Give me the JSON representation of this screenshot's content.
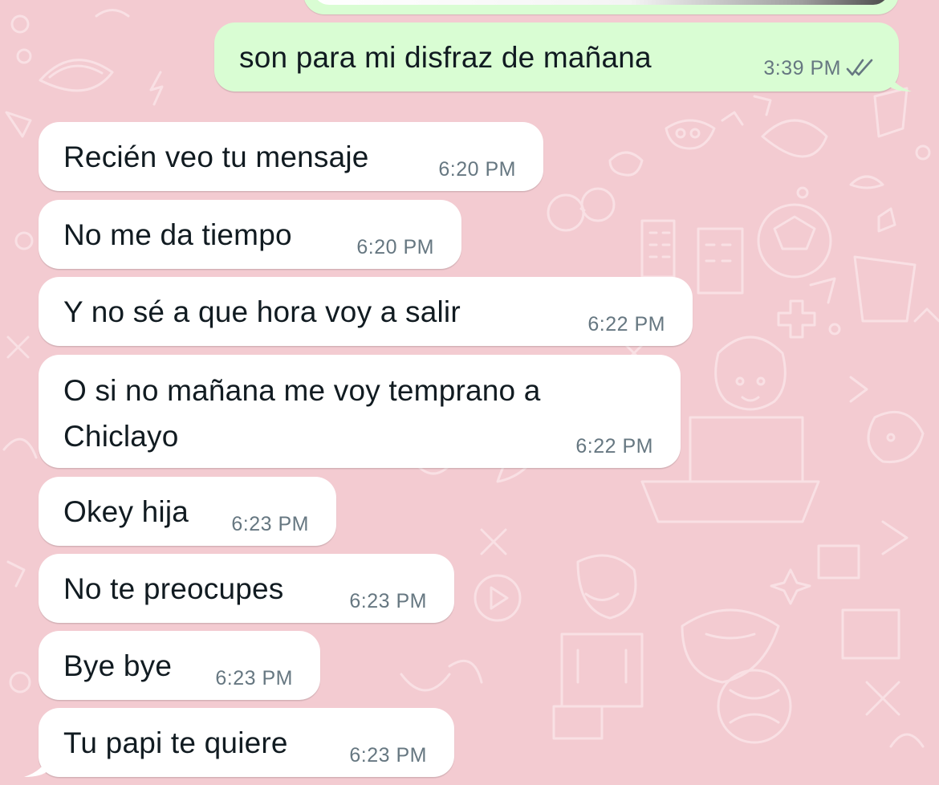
{
  "chat": {
    "colors": {
      "wallpaper": "#f3cbd1",
      "incoming_bubble": "#ffffff",
      "outgoing_bubble": "#d9fdd3",
      "timestamp": "#667781",
      "read_ticks": "#667781"
    },
    "outgoing": [
      {
        "text": "son para mi disfraz de mañana",
        "time": "3:39 PM",
        "status": "read",
        "status_icon": "double-check-icon"
      }
    ],
    "incoming": [
      {
        "text": "Recién veo tu mensaje",
        "time": "6:20 PM"
      },
      {
        "text": "No me da tiempo",
        "time": "6:20 PM"
      },
      {
        "text": "Y no sé a que hora voy a salir",
        "time": "6:22 PM"
      },
      {
        "text": "O si no mañana me voy temprano a Chiclayo",
        "time": "6:22 PM"
      },
      {
        "text": "Okey hija",
        "time": "6:23 PM"
      },
      {
        "text": "No te preocupes",
        "time": "6:23 PM"
      },
      {
        "text": "Bye bye",
        "time": "6:23 PM"
      },
      {
        "text": "Tu papi te quiere",
        "time": "6:23 PM"
      }
    ]
  }
}
